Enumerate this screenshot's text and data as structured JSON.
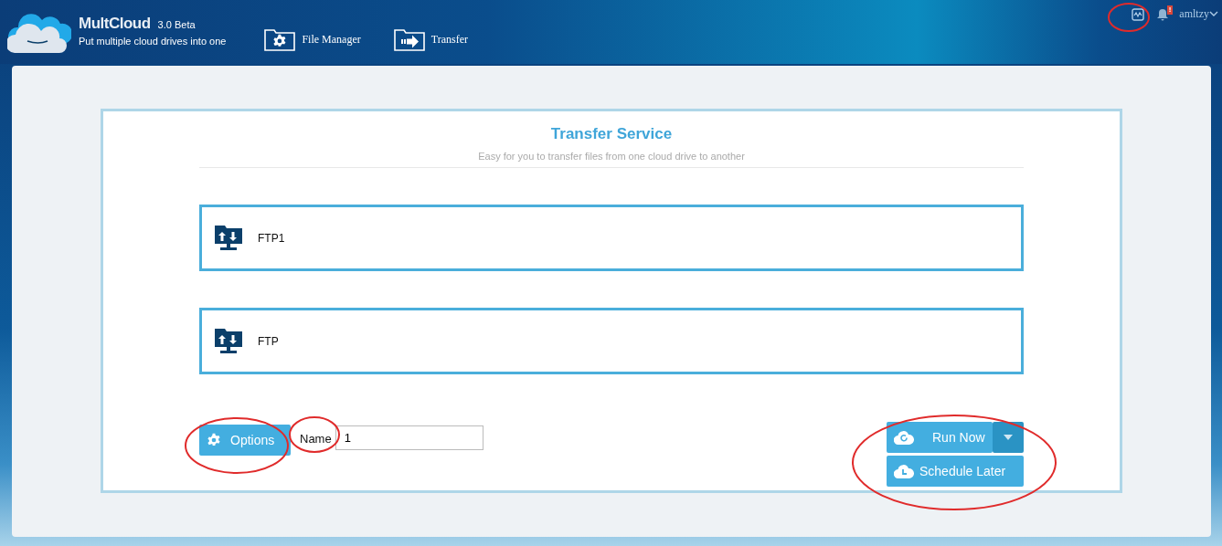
{
  "header": {
    "logo": "MultCloud",
    "version": "3.0 Beta",
    "tagline": "Put multiple cloud drives into one",
    "nav": [
      {
        "label": "File Manager",
        "kind": "gear"
      },
      {
        "label": "Transfer",
        "kind": "arrow"
      }
    ],
    "notification_badge": "!",
    "user": "amltzy"
  },
  "card": {
    "title": "Transfer Service",
    "subtitle": "Easy for you to transfer files from one cloud drive to another",
    "drives": [
      {
        "name": "FTP1"
      },
      {
        "name": "FTP"
      }
    ]
  },
  "footer": {
    "options_button": "Options",
    "name_label": "Name",
    "name_value": "1",
    "run_button": "Run Now",
    "schedule_button": "Schedule Later"
  }
}
